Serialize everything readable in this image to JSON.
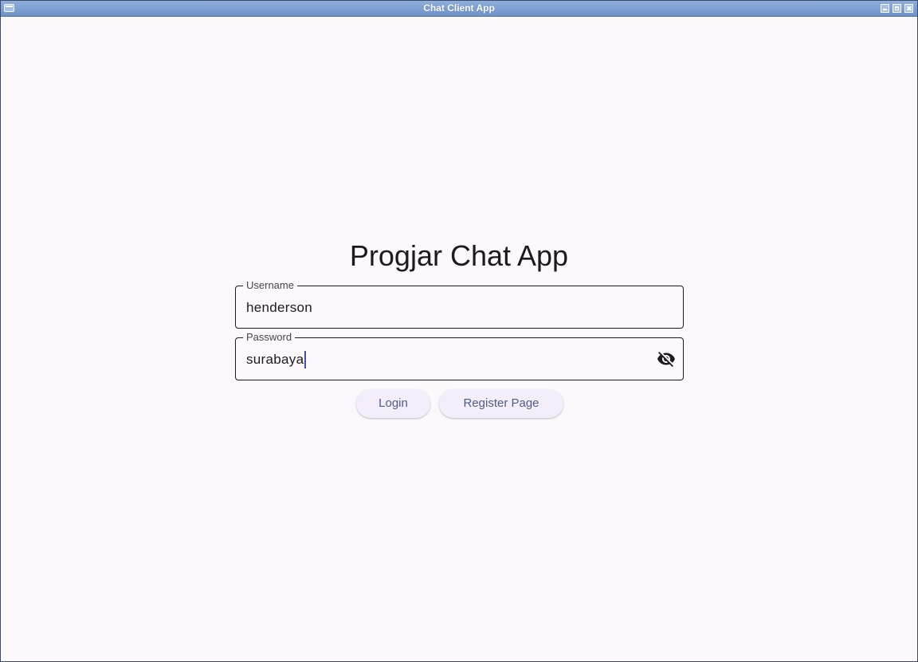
{
  "window": {
    "title": "Chat Client App"
  },
  "app": {
    "heading": "Progjar Chat App"
  },
  "form": {
    "username": {
      "label": "Username",
      "value": "henderson"
    },
    "password": {
      "label": "Password",
      "value": "surabaya",
      "toggle_icon": "visibility-off-icon"
    }
  },
  "actions": {
    "login_label": "Login",
    "register_label": "Register Page"
  },
  "colors": {
    "background": "#fcf8fc",
    "titlebar": "#7d9fd3",
    "button_text": "#4e5d88",
    "button_bg": "#f3eef9"
  }
}
